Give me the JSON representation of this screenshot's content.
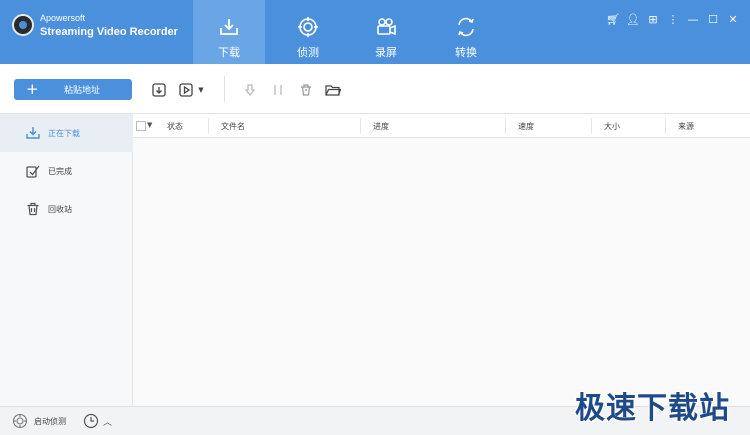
{
  "brand": {
    "line1": "Apowersoft",
    "line2": "Streaming Video Recorder"
  },
  "nav": {
    "tabs": [
      {
        "label": "下载",
        "icon": "download-icon",
        "active": true
      },
      {
        "label": "侦测",
        "icon": "detect-icon",
        "active": false
      },
      {
        "label": "录屏",
        "icon": "camera-icon",
        "active": false
      },
      {
        "label": "转换",
        "icon": "convert-icon",
        "active": false
      }
    ]
  },
  "window_controls": [
    "cart-icon",
    "user-icon",
    "apps-icon",
    "menu-icon",
    "minimize-icon",
    "maximize-icon",
    "close-icon"
  ],
  "toolbar": {
    "paste_label": "粘贴地址"
  },
  "sidebar": {
    "items": [
      {
        "label": "正在下载",
        "icon": "download-icon",
        "active": true
      },
      {
        "label": "已完成",
        "icon": "check-icon",
        "active": false
      },
      {
        "label": "回收站",
        "icon": "trash-icon",
        "active": false
      }
    ]
  },
  "table": {
    "columns": [
      "状态",
      "文件名",
      "进度",
      "速度",
      "大小",
      "来源"
    ]
  },
  "footer": {
    "detect_label": "启动侦测"
  },
  "watermark": "极速下载站",
  "colors": {
    "accent": "#4a90dc",
    "active_tab": "#6aa6e6"
  }
}
